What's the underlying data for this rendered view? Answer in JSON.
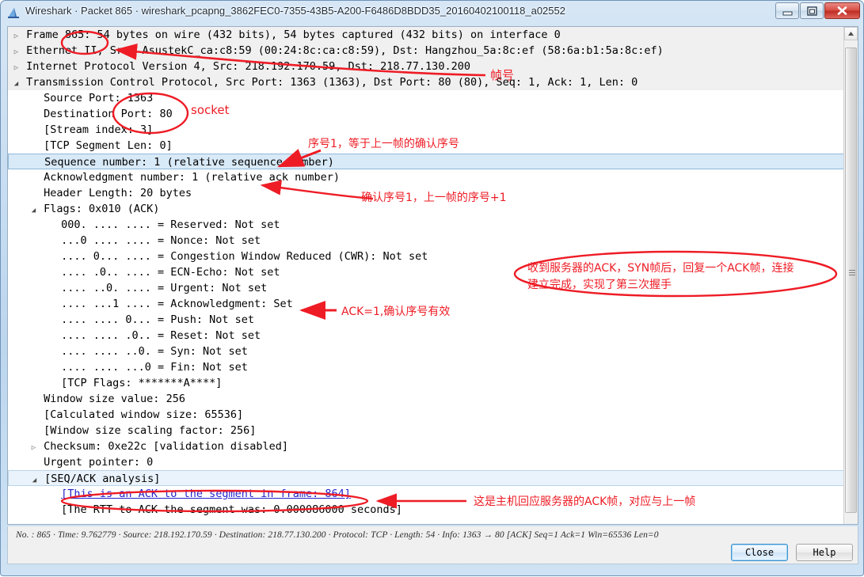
{
  "window": {
    "title": "Wireshark · Packet 865 · wireshark_pcapng_3862FEC0-7355-43B5-A200-F6486D8BDD35_20160402100118_a02552",
    "icon": "wireshark-shark-fin-icon",
    "minimize_label": "minimize-icon",
    "maximize_label": "maximize-icon",
    "close_label": "close-icon"
  },
  "packet_tree": {
    "rows": [
      {
        "indent": 0,
        "toggle": "collapsed",
        "text": "Frame 865: 54 bytes on wire (432 bits), 54 bytes captured (432 bits) on interface 0",
        "style": "band"
      },
      {
        "indent": 0,
        "toggle": "collapsed",
        "text": "Ethernet II, Src: AsustekC_ca:c8:59 (00:24:8c:ca:c8:59), Dst: Hangzhou_5a:8c:ef (58:6a:b1:5a:8c:ef)",
        "style": "band"
      },
      {
        "indent": 0,
        "toggle": "collapsed",
        "text": "Internet Protocol Version 4, Src: 218.192.170.59, Dst: 218.77.130.200",
        "style": "band"
      },
      {
        "indent": 0,
        "toggle": "expanded",
        "text": "Transmission Control Protocol, Src Port: 1363 (1363), Dst Port: 80 (80), Seq: 1, Ack: 1, Len: 0",
        "style": "band"
      },
      {
        "indent": 1,
        "toggle": "none",
        "text": "Source Port: 1363",
        "style": "plain"
      },
      {
        "indent": 1,
        "toggle": "none",
        "text": "Destination Port: 80",
        "style": "plain"
      },
      {
        "indent": 1,
        "toggle": "none",
        "text": "[Stream index: 3]",
        "style": "plain"
      },
      {
        "indent": 1,
        "toggle": "none",
        "text": "[TCP Segment Len: 0]",
        "style": "plain"
      },
      {
        "indent": 1,
        "toggle": "none",
        "text": "Sequence number: 1    (relative sequence number)",
        "style": "selected"
      },
      {
        "indent": 1,
        "toggle": "none",
        "text": "Acknowledgment number: 1    (relative ack number)",
        "style": "plain"
      },
      {
        "indent": 1,
        "toggle": "none",
        "text": "Header Length: 20 bytes",
        "style": "plain"
      },
      {
        "indent": 1,
        "toggle": "expanded",
        "text": "Flags: 0x010 (ACK)",
        "style": "plain"
      },
      {
        "indent": 2,
        "toggle": "none",
        "text": "000. .... .... = Reserved: Not set",
        "style": "plain"
      },
      {
        "indent": 2,
        "toggle": "none",
        "text": "...0 .... .... = Nonce: Not set",
        "style": "plain"
      },
      {
        "indent": 2,
        "toggle": "none",
        "text": ".... 0... .... = Congestion Window Reduced (CWR): Not set",
        "style": "plain"
      },
      {
        "indent": 2,
        "toggle": "none",
        "text": ".... .0.. .... = ECN-Echo: Not set",
        "style": "plain"
      },
      {
        "indent": 2,
        "toggle": "none",
        "text": ".... ..0. .... = Urgent: Not set",
        "style": "plain"
      },
      {
        "indent": 2,
        "toggle": "none",
        "text": ".... ...1 .... = Acknowledgment: Set",
        "style": "plain"
      },
      {
        "indent": 2,
        "toggle": "none",
        "text": ".... .... 0... = Push: Not set",
        "style": "plain"
      },
      {
        "indent": 2,
        "toggle": "none",
        "text": ".... .... .0.. = Reset: Not set",
        "style": "plain"
      },
      {
        "indent": 2,
        "toggle": "none",
        "text": ".... .... ..0. = Syn: Not set",
        "style": "plain"
      },
      {
        "indent": 2,
        "toggle": "none",
        "text": ".... .... ...0 = Fin: Not set",
        "style": "plain"
      },
      {
        "indent": 2,
        "toggle": "none",
        "text": "[TCP Flags: *******A****]",
        "style": "plain"
      },
      {
        "indent": 1,
        "toggle": "none",
        "text": "Window size value: 256",
        "style": "plain"
      },
      {
        "indent": 1,
        "toggle": "none",
        "text": "[Calculated window size: 65536]",
        "style": "plain"
      },
      {
        "indent": 1,
        "toggle": "none",
        "text": "[Window size scaling factor: 256]",
        "style": "plain"
      },
      {
        "indent": 1,
        "toggle": "collapsed",
        "text": "Checksum: 0xe22c [validation disabled]",
        "style": "plain"
      },
      {
        "indent": 1,
        "toggle": "none",
        "text": "Urgent pointer: 0",
        "style": "plain"
      },
      {
        "indent": 1,
        "toggle": "expanded",
        "text": "[SEQ/ACK analysis]",
        "style": "selband"
      },
      {
        "indent": 2,
        "toggle": "none",
        "text": "[This is an ACK to the segment in frame: 864]",
        "style": "link"
      },
      {
        "indent": 2,
        "toggle": "none",
        "text": "[The RTT to ACK the segment was: 0.000086000 seconds]",
        "style": "plain"
      }
    ]
  },
  "statusbar": {
    "text": "No. : 865  ·  Time: 9.762779  ·  Source: 218.192.170.59  ·  Destination: 218.77.130.200  ·  Protocol: TCP  ·  Length: 54  ·  Info: 1363 → 80 [ACK] Seq=1 Ack=1 Win=65536 Len=0",
    "close_button": "Close",
    "help_button": "Help"
  },
  "annotations": {
    "accent_color": "#ee1c25",
    "socket": "socket",
    "frame_number": "帧号",
    "sequence_note": "序号1，等于上一帧的确认序号",
    "ack_note": "确认序号1，上一帧的序号+1",
    "ack_flag_note": "ACK=1,确认序号有效",
    "handshake_note_line1": "收到服务器的ACK，SYN帧后，回复一个ACK帧，连接",
    "handshake_note_line2": "建立完成，实现了第三次握手",
    "bottom_note": "这是主机回应服务器的ACK帧，对应与上一帧"
  }
}
